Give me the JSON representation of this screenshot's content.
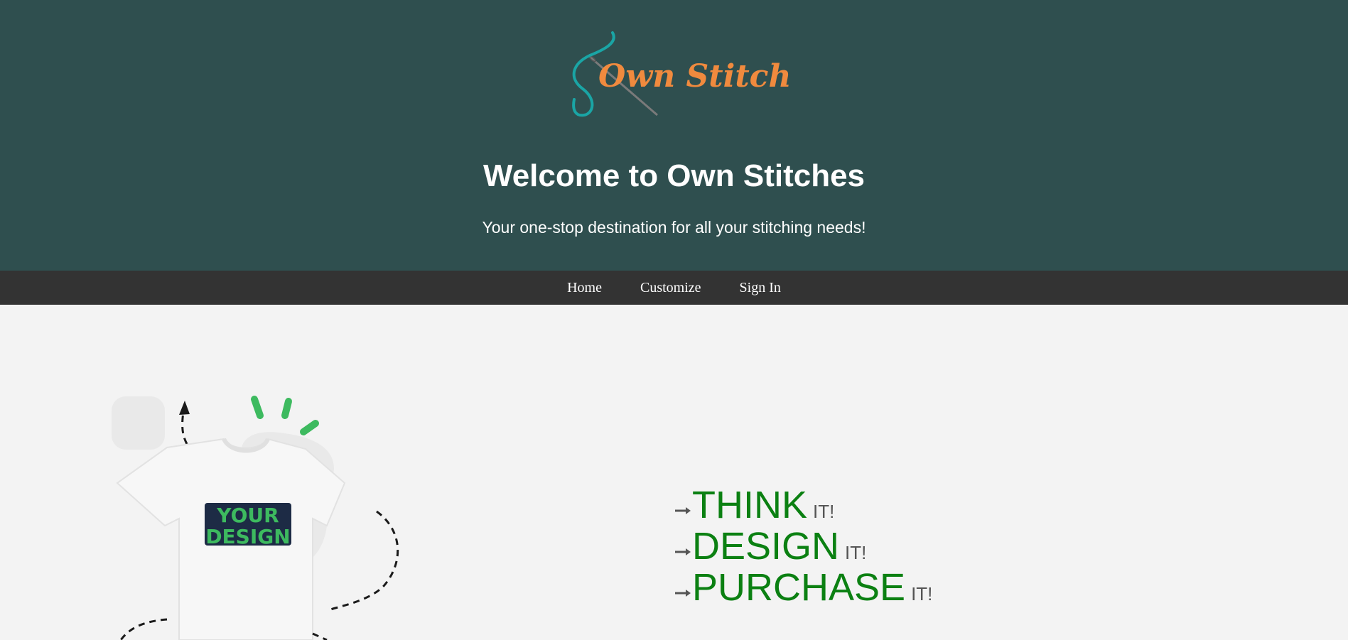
{
  "brand": {
    "name": "Own Stitches",
    "colors": {
      "header_bg": "#2f4f4f",
      "nav_bg": "#333333",
      "logo_text": "#f08a3e",
      "thread": "#1aa5a5",
      "step_text": "#0b8012",
      "shirt_design": "#3dba5f"
    }
  },
  "hero": {
    "title": "Welcome to Own Stitches",
    "subtitle": "Your one-stop destination for all your stitching needs!"
  },
  "nav": {
    "items": [
      {
        "label": "Home"
      },
      {
        "label": "Customize"
      },
      {
        "label": "Sign In"
      }
    ]
  },
  "illustration": {
    "shirt_text_line1": "YOUR",
    "shirt_text_line2": "DESIGN"
  },
  "steps": [
    {
      "word": "THINK",
      "suffix": "IT!"
    },
    {
      "word": "DESIGN",
      "suffix": "IT!"
    },
    {
      "word": "PURCHASE",
      "suffix": "IT!"
    }
  ]
}
